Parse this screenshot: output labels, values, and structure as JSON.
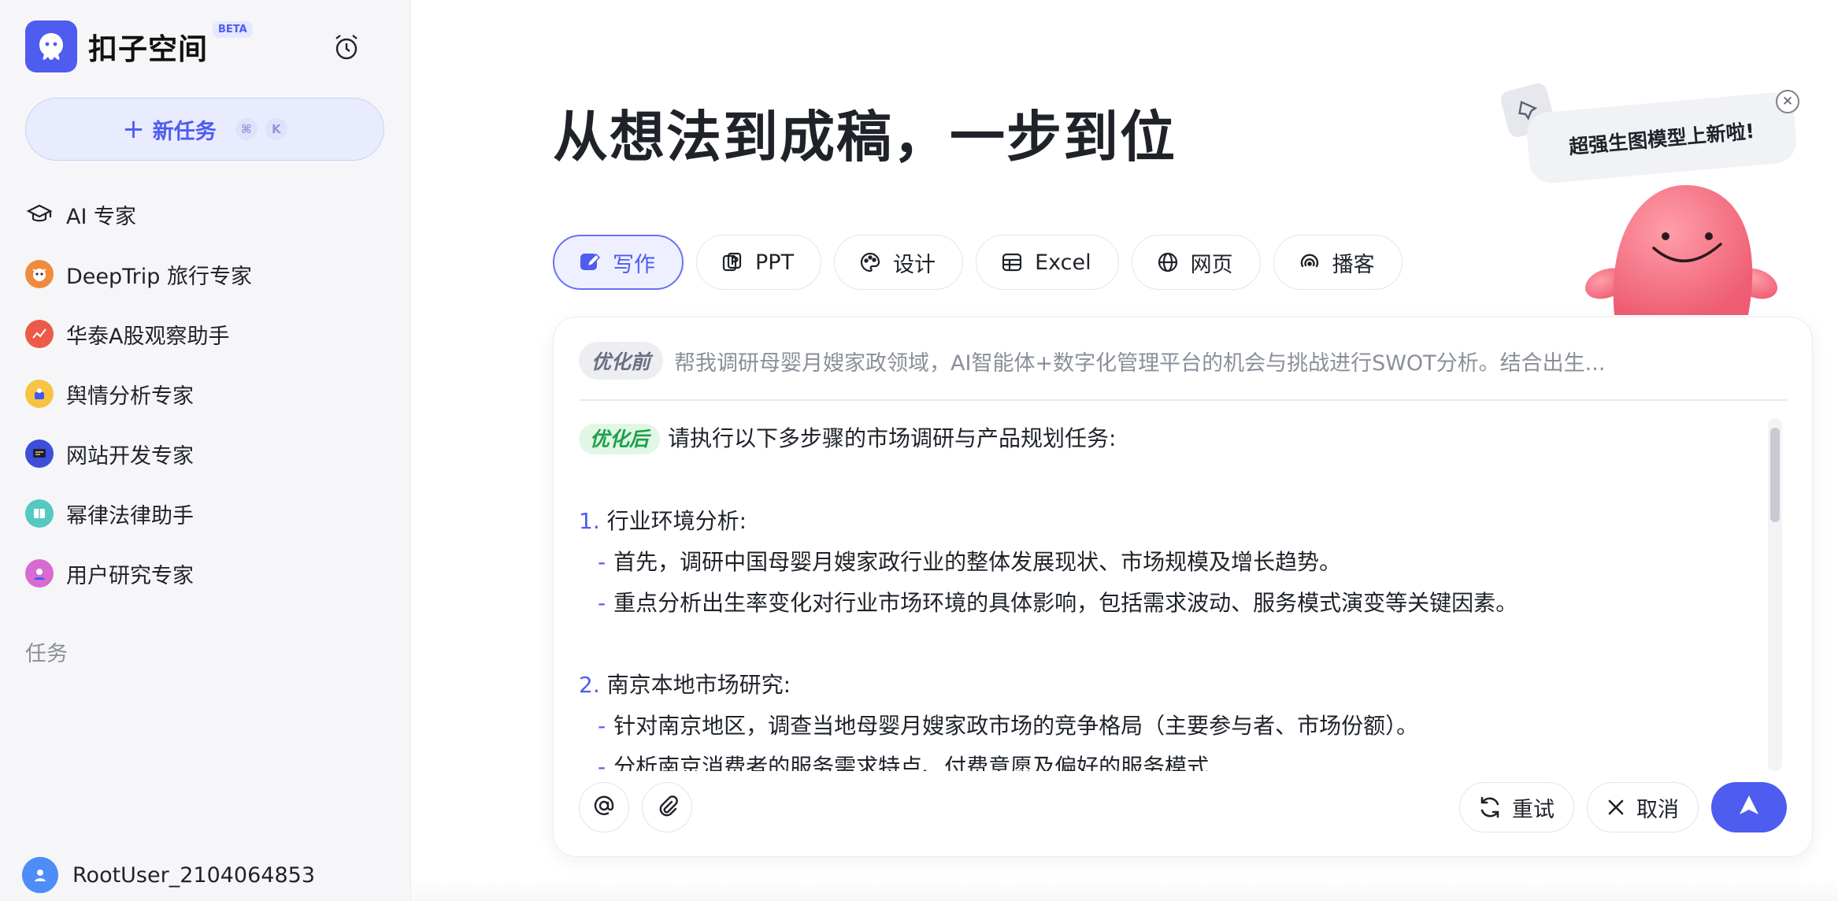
{
  "sidebar": {
    "brand": {
      "name": "扣子空间",
      "badge": "BETA"
    },
    "new_task": {
      "label": "新任务",
      "shortcut": [
        "⌘",
        "K"
      ]
    },
    "nav_items": [
      {
        "label": "AI 专家",
        "icon": "graduation-cap-icon"
      },
      {
        "label": "DeepTrip 旅行专家",
        "icon": "deeptrip-avatar"
      },
      {
        "label": "华泰A股观察助手",
        "icon": "huatai-avatar"
      },
      {
        "label": "舆情分析专家",
        "icon": "sentiment-avatar"
      },
      {
        "label": "网站开发专家",
        "icon": "webdev-avatar"
      },
      {
        "label": "幂律法律助手",
        "icon": "law-avatar"
      },
      {
        "label": "用户研究专家",
        "icon": "userresearch-avatar"
      }
    ],
    "section_label": "任务",
    "user": {
      "name": "RootUser_2104064853"
    }
  },
  "main": {
    "headline": "从想法到成稿，一步到位",
    "tabs": [
      {
        "label": "写作",
        "active": true
      },
      {
        "label": "PPT"
      },
      {
        "label": "设计"
      },
      {
        "label": "Excel"
      },
      {
        "label": "网页"
      },
      {
        "label": "播客"
      }
    ],
    "promo": {
      "text": "超强生图模型上新啦!"
    },
    "editor": {
      "before_tag": "优化前",
      "before_text": "帮我调研母婴月嫂家政领域，AI智能体+数字化管理平台的机会与挑战进行SWOT分析。结合出生...",
      "after_tag": "优化后",
      "after_intro": "请执行以下多步骤的市场调研与产品规划任务:",
      "sections": [
        {
          "num": "1.",
          "title": "行业环境分析:",
          "bullets": [
            "首先，调研中国母婴月嫂家政行业的整体发展现状、市场规模及增长趋势。",
            "重点分析出生率变化对行业市场环境的具体影响，包括需求波动、服务模式演变等关键因素。"
          ]
        },
        {
          "num": "2.",
          "title": "南京本地市场研究:",
          "bullets": [
            "针对南京地区，调查当地母婴月嫂家政市场的竞争格局（主要参与者、市场份额）。",
            "分析南京消费者的服务需求特点、付费意愿及偏好的服务模式"
          ]
        }
      ],
      "retry_label": "重试",
      "cancel_label": "取消"
    }
  },
  "colors": {
    "accent": "#4e5cf0",
    "optimized_green": "#1aa14a"
  }
}
